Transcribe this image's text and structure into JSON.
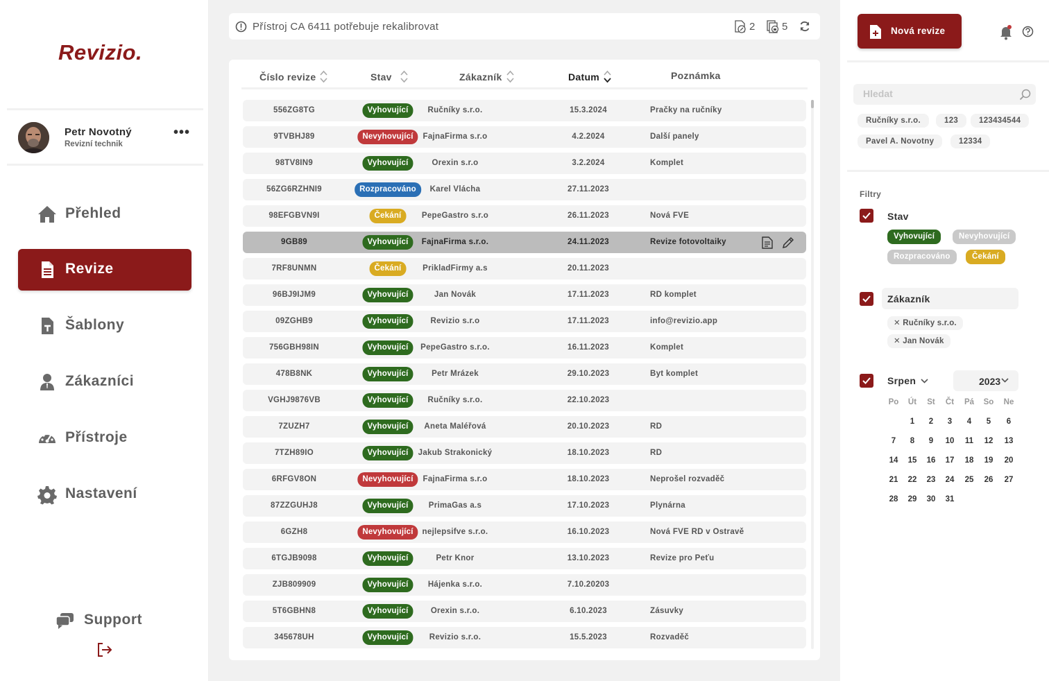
{
  "app": {
    "logo": "Revizio."
  },
  "user": {
    "name": "Petr Novotný",
    "role": "Revizní technik",
    "more": "•••"
  },
  "nav": [
    {
      "label": "Přehled",
      "icon": "home-icon"
    },
    {
      "label": "Revize",
      "icon": "document-icon",
      "active": true
    },
    {
      "label": "Šablony",
      "icon": "template-icon"
    },
    {
      "label": "Zákazníci",
      "icon": "user-icon"
    },
    {
      "label": "Přístroje",
      "icon": "gauge-icon"
    },
    {
      "label": "Nastavení",
      "icon": "gear-icon"
    }
  ],
  "support": {
    "label": "Support"
  },
  "alert": {
    "text": "Přístroj CA 6411 potřebuje rekalibrovat",
    "count_devices": "2",
    "count_docs": "5"
  },
  "table": {
    "headers": {
      "id": "Číslo revize",
      "status": "Stav",
      "customer": "Zákazník",
      "date": "Datum",
      "note": "Poznámka"
    },
    "rows": [
      {
        "id": "556ZG8TG",
        "status": "Vyhovující",
        "kind": "ok",
        "customer": "Ručníky s.r.o.",
        "date": "15.3.2024",
        "note": "Pračky na ručníky"
      },
      {
        "id": "9TVBHJ89",
        "status": "Nevyhovující",
        "kind": "bad",
        "customer": "FajnaFirma s.r.o",
        "date": "4.2.2024",
        "note": "Další panely"
      },
      {
        "id": "98TV8IN9",
        "status": "Vyhovující",
        "kind": "ok",
        "customer": "Orexin s.r.o",
        "date": "3.2.2024",
        "note": "Komplet"
      },
      {
        "id": "56ZG6RZHNI9",
        "status": "Rozpracováno",
        "kind": "wip",
        "customer": "Karel Vlácha",
        "date": "27.11.2023",
        "note": ""
      },
      {
        "id": "98EFGBVN9I",
        "status": "Čekání",
        "kind": "wait",
        "customer": "PepeGastro s.r.o",
        "date": "26.11.2023",
        "note": "Nová FVE"
      },
      {
        "id": "9GB89",
        "status": "Vyhovující",
        "kind": "ok",
        "customer": "FajnaFirma s.r.o.",
        "date": "24.11.2023",
        "note": "Revize fotovoltaiky",
        "selected": true
      },
      {
        "id": "7RF8UNMN",
        "status": "Čekání",
        "kind": "wait",
        "customer": "PrikladFirmy a.s",
        "date": "20.11.2023",
        "note": ""
      },
      {
        "id": "96BJ9IJM9",
        "status": "Vyhovující",
        "kind": "ok",
        "customer": "Jan Novák",
        "date": "17.11.2023",
        "note": "RD komplet"
      },
      {
        "id": "09ZGHB9",
        "status": "Vyhovující",
        "kind": "ok",
        "customer": "Revizio s.r.o",
        "date": "17.11.2023",
        "note": "info@revizio.app"
      },
      {
        "id": "756GBH98IN",
        "status": "Vyhovující",
        "kind": "ok",
        "customer": "PepeGastro s.r.o.",
        "date": "16.11.2023",
        "note": "Komplet"
      },
      {
        "id": "478B8NK",
        "status": "Vyhovující",
        "kind": "ok",
        "customer": "Petr Mrázek",
        "date": "29.10.2023",
        "note": "Byt komplet"
      },
      {
        "id": "VGHJ9876VB",
        "status": "Vyhovující",
        "kind": "ok",
        "customer": "Ručníky s.r.o.",
        "date": "22.10.2023",
        "note": ""
      },
      {
        "id": "7ZUZH7",
        "status": "Vyhovující",
        "kind": "ok",
        "customer": "Aneta Maléřová",
        "date": "20.10.2023",
        "note": "RD"
      },
      {
        "id": "7TZH89IO",
        "status": "Vyhovující",
        "kind": "ok",
        "customer": "Jakub Strakonický",
        "date": "18.10.2023",
        "note": "RD"
      },
      {
        "id": "6RFGV8ON",
        "status": "Nevyhovující",
        "kind": "bad",
        "customer": "FajnaFirma s.r.o",
        "date": "18.10.2023",
        "note": "Neprošel rozvaděč"
      },
      {
        "id": "87ZZGUHJ8",
        "status": "Vyhovující",
        "kind": "ok",
        "customer": "PrimaGas a.s",
        "date": "17.10.2023",
        "note": "Plynárna"
      },
      {
        "id": "6GZH8",
        "status": "Nevyhovující",
        "kind": "bad",
        "customer": "nejlepsifve s.r.o.",
        "date": "16.10.2023",
        "note": "Nová FVE RD v Ostravě"
      },
      {
        "id": "6TGJB9098",
        "status": "Vyhovující",
        "kind": "ok",
        "customer": "Petr Knor",
        "date": "13.10.2023",
        "note": "Revize pro Peťu"
      },
      {
        "id": "ZJB809909",
        "status": "Vyhovující",
        "kind": "ok",
        "customer": "Hájenka s.r.o.",
        "date": "7.10.20203",
        "note": ""
      },
      {
        "id": "5T6GBHN8",
        "status": "Vyhovující",
        "kind": "ok",
        "customer": "Orexin s.r.o.",
        "date": "6.10.2023",
        "note": "Zásuvky"
      },
      {
        "id": "345678UH",
        "status": "Vyhovující",
        "kind": "ok",
        "customer": "Revizio s.r.o.",
        "date": "15.5.2023",
        "note": "Rozvaděč"
      }
    ]
  },
  "right": {
    "new_button": "Nová revize",
    "search_placeholder": "Hledat",
    "recent": [
      "Ručníky s.r.o.",
      "123",
      "123434544",
      "Pavel A. Novotny",
      "12334"
    ],
    "filters_title": "Filtry",
    "status_filter": {
      "label": "Stav",
      "tags": [
        {
          "label": "Vyhovující",
          "kind": "ok"
        },
        {
          "label": "Nevyhovující",
          "kind": "off"
        },
        {
          "label": "Rozpracováno",
          "kind": "off"
        },
        {
          "label": "Čekání",
          "kind": "wait"
        }
      ]
    },
    "customer_filter": {
      "label": "Zákazník",
      "selected": [
        "Ručníky s.r.o.",
        "Jan Novák"
      ]
    },
    "calendar": {
      "month": "Srpen",
      "year": "2023",
      "weekdays": [
        "Po",
        "Út",
        "St",
        "Čt",
        "Pá",
        "So",
        "Ne"
      ],
      "first_weekday_index": 1,
      "days": 31
    }
  },
  "colors": {
    "brand": "#8b1a1a",
    "ok": "#2e6b1f",
    "bad": "#c0393b",
    "wip": "#2a6fb5",
    "wait": "#d9ab22"
  }
}
